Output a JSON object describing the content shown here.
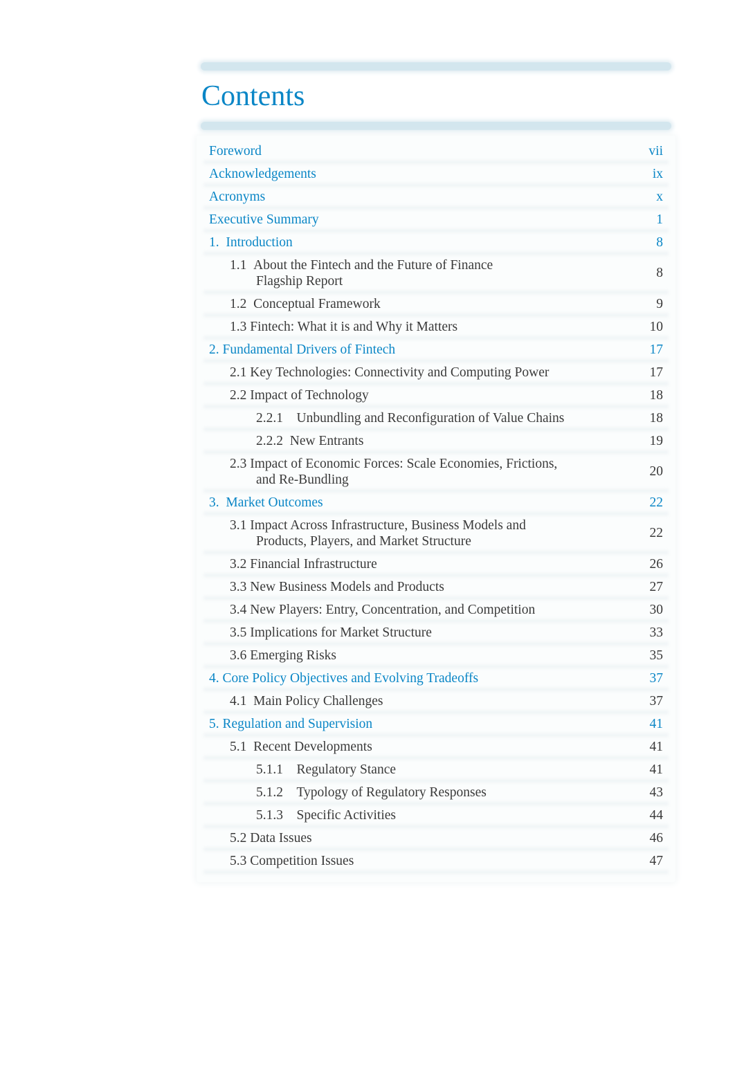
{
  "header": {
    "title": "Contents"
  },
  "toc": [
    {
      "level": 0,
      "num": "",
      "text": "Foreword",
      "page": "vii"
    },
    {
      "level": 0,
      "num": "",
      "text": "Acknowledgements",
      "page": "ix"
    },
    {
      "level": 0,
      "num": "",
      "text": "Acronyms",
      "page": "x"
    },
    {
      "level": 0,
      "num": "",
      "text": "Executive Summary",
      "page": "1"
    },
    {
      "level": 0,
      "num": "1.  ",
      "text": "Introduction",
      "page": "8"
    },
    {
      "level": 1,
      "num": "1.1  ",
      "text": "About the Fintech and the Future of Finance",
      "cont": "Flagship Report",
      "page": "8"
    },
    {
      "level": 1,
      "num": "1.2  ",
      "text": "Conceptual  Framework",
      "page": "9"
    },
    {
      "level": 1,
      "num": "1.3 ",
      "text": "Fintech: What it is and Why it Matters",
      "page": "10"
    },
    {
      "level": 0,
      "num": "2. ",
      "text": "Fundamental Drivers of Fintech",
      "page": "17"
    },
    {
      "level": 1,
      "num": "2.1 ",
      "text": "Key Technologies: Connectivity and Computing Power",
      "page": "17"
    },
    {
      "level": 1,
      "num": "2.2 ",
      "text": "Impact of Technology",
      "page": "18"
    },
    {
      "level": 2,
      "num": "2.2.1    ",
      "text": "Unbundling and Reconfiguration of Value Chains",
      "page": "18"
    },
    {
      "level": 2,
      "num": "2.2.2  ",
      "text": "New  Entrants",
      "page": "19"
    },
    {
      "level": 1,
      "num": "2.3 ",
      "text": "Impact of Economic Forces: Scale Economies, Frictions,",
      "cont": "and Re-Bundling",
      "page": "20"
    },
    {
      "level": 0,
      "num": "3.  ",
      "text": "Market Outcomes",
      "page": "22"
    },
    {
      "level": 1,
      "num": "3.1 ",
      "text": "Impact Across Infrastructure, Business Models and",
      "cont": "Products, Players, and Market Structure",
      "page": "22"
    },
    {
      "level": 1,
      "num": "3.2 ",
      "text": "Financial  Infrastructure",
      "page": "26"
    },
    {
      "level": 1,
      "num": "3.3 ",
      "text": "New Business Models and Products",
      "page": "27"
    },
    {
      "level": 1,
      "num": "3.4 ",
      "text": "New Players: Entry, Concentration, and Competition",
      "page": "30"
    },
    {
      "level": 1,
      "num": "3.5 ",
      "text": "Implications for Market Structure",
      "page": "33"
    },
    {
      "level": 1,
      "num": "3.6 ",
      "text": "Emerging Risks",
      "page": "35"
    },
    {
      "level": 0,
      "num": "4. ",
      "text": "Core Policy Objectives and Evolving Tradeoffs",
      "page": "37"
    },
    {
      "level": 1,
      "num": "4.1  ",
      "text": "Main  Policy  Challenges",
      "page": "37"
    },
    {
      "level": 0,
      "num": "5. ",
      "text": "Regulation and Supervision",
      "page": "41"
    },
    {
      "level": 1,
      "num": "5.1  ",
      "text": "Recent  Developments",
      "page": "41"
    },
    {
      "level": 2,
      "num": "5.1.1    ",
      "text": "Regulatory Stance",
      "page": "41"
    },
    {
      "level": 2,
      "num": "5.1.2    ",
      "text": "Typology of Regulatory Responses",
      "page": "43"
    },
    {
      "level": 2,
      "num": "5.1.3    ",
      "text": "Specific Activities",
      "page": "44"
    },
    {
      "level": 1,
      "num": "5.2 ",
      "text": "Data  Issues",
      "page": "46"
    },
    {
      "level": 1,
      "num": "5.3 ",
      "text": "Competition  Issues",
      "page": "47"
    }
  ]
}
